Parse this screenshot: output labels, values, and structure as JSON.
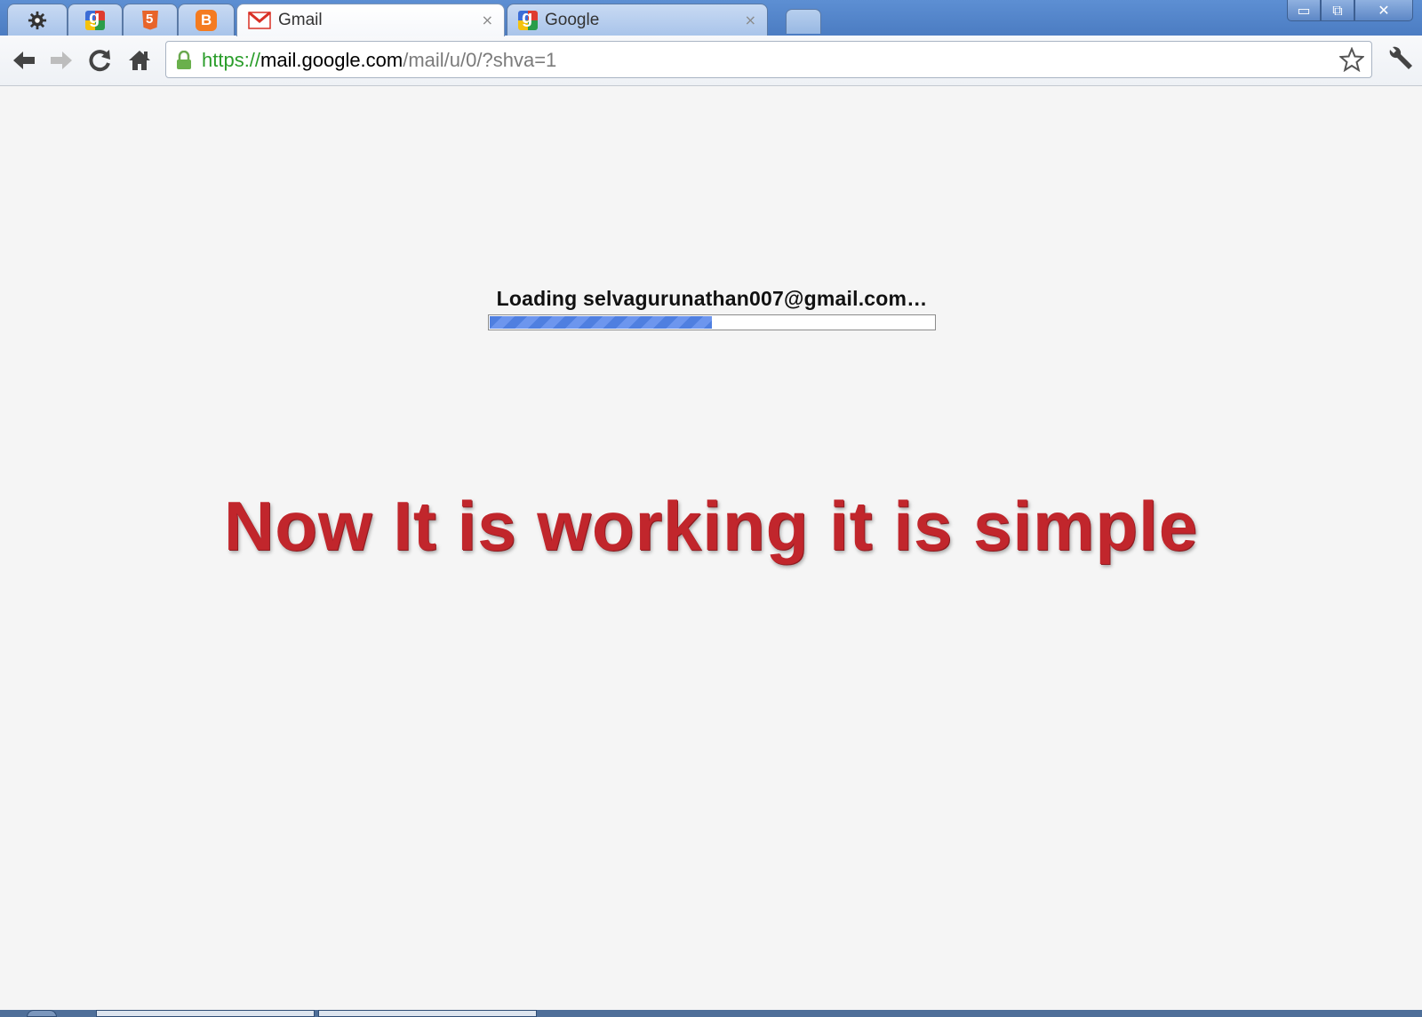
{
  "tabs": [
    {
      "type": "pinned",
      "icon": "settings-gear-icon",
      "title": ""
    },
    {
      "type": "pinned",
      "icon": "google-icon",
      "title": ""
    },
    {
      "type": "pinned",
      "icon": "html5-icon",
      "title": ""
    },
    {
      "type": "pinned",
      "icon": "blogger-icon",
      "title": ""
    },
    {
      "type": "active",
      "icon": "gmail-icon",
      "title": "Gmail"
    },
    {
      "type": "normal",
      "icon": "google-icon",
      "title": "Google"
    }
  ],
  "tab_close_glyph": "×",
  "window_controls": {
    "minimize": "▭",
    "restore": "⧉",
    "close": "✕"
  },
  "address_bar": {
    "scheme": "https://",
    "host": "mail.google.com",
    "path": "/mail/u/0/?shva=1"
  },
  "page": {
    "loading_text": "Loading selvagurunathan007@gmail.com…",
    "progress": 0.5,
    "overlay_text": "Now It is working it is simple"
  },
  "colors": {
    "url_scheme": "#2a9d2a",
    "overlay_text": "#c1262c",
    "progress_fill": "#4f7fe0"
  }
}
